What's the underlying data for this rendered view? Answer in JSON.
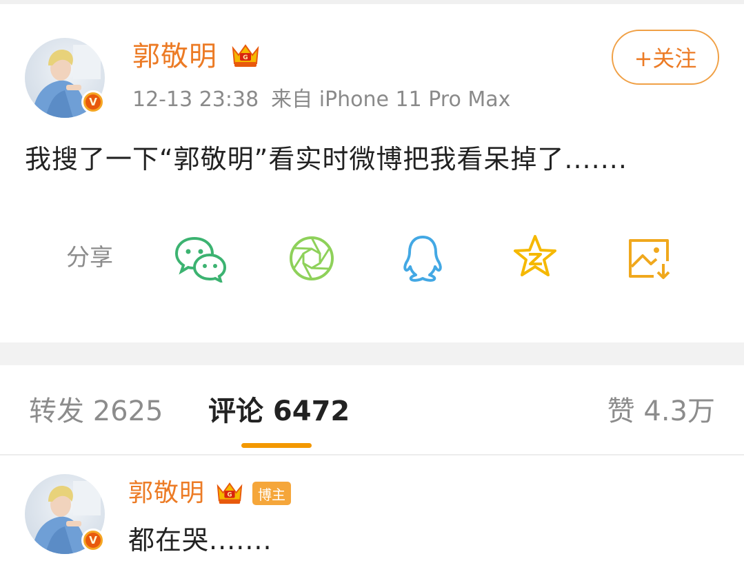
{
  "post": {
    "author": "郭敬明",
    "time": "12-13 23:38",
    "source": "来自 iPhone 11 Pro Max",
    "follow_label": "+关注",
    "content": "我搜了一下“郭敬明”看实时微博把我看呆掉了.......",
    "verified_badge": "V"
  },
  "share": {
    "label": "分享",
    "targets": [
      {
        "name": "wechat-icon",
        "color": "#3cb371"
      },
      {
        "name": "moments-icon",
        "color": "#8ed15a"
      },
      {
        "name": "qq-icon",
        "color": "#43a8e4"
      },
      {
        "name": "qzone-icon",
        "color": "#f5b800"
      },
      {
        "name": "save-image-icon",
        "color": "#f0a81d"
      }
    ]
  },
  "tabs": {
    "repost": "转发 2625",
    "comments": "评论 6472",
    "likes": "赞 4.3万",
    "active": "comments"
  },
  "comment": {
    "author": "郭敬明",
    "badge": "博主",
    "text": "都在哭.......",
    "verified_badge": "V"
  },
  "colors": {
    "accent": "#ec7b25",
    "tab_underline": "#f39800",
    "text": "#222222",
    "muted": "#8c8c8c"
  }
}
